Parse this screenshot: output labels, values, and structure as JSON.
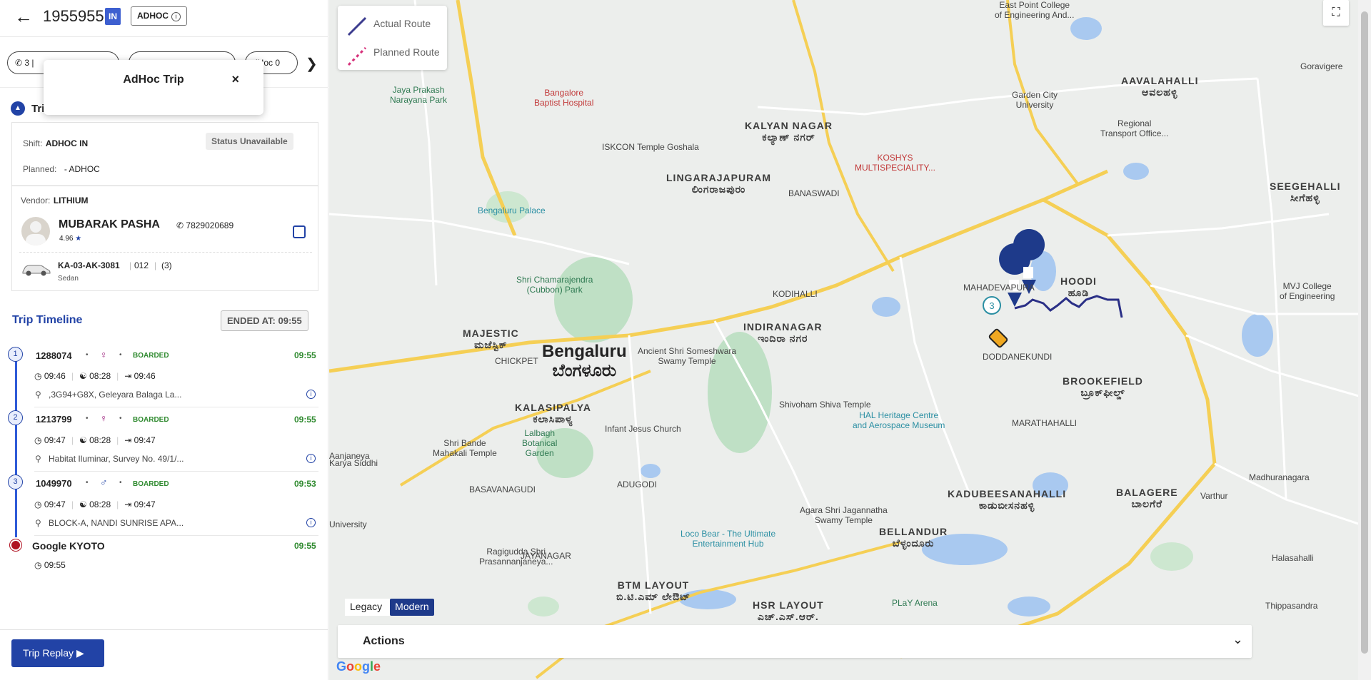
{
  "header": {
    "trip_id": "1955955",
    "direction_badge": "IN",
    "type_badge": "ADHOC",
    "info_icon": "info-icon",
    "back_icon": "arrow-left-icon"
  },
  "chips": {
    "first_count": "3",
    "third_label": "dHoc 0",
    "next_icon": "chevron-right-icon",
    "dot_colors": [
      "#3bb143",
      "#d32f2f"
    ]
  },
  "popup": {
    "title": "AdHoc Trip",
    "close": "×"
  },
  "trip": {
    "collapse_icon": "chevron-up-icon",
    "label": "Tri",
    "shift_label": "Shift:",
    "shift_value": "ADHOC IN",
    "status": "Status Unavailable",
    "planned_label": "Planned:",
    "planned_value": "- ADHOC"
  },
  "vendor": {
    "label": "Vendor:",
    "value": "LITHIUM"
  },
  "driver": {
    "name": "MUBARAK PASHA",
    "phone": "7829020689",
    "rating": "4.96",
    "edit_icon": "edit-icon"
  },
  "vehicle": {
    "plate": "KA-03-AK-3081",
    "code": "012",
    "count": "(3)",
    "type": "Sedan",
    "icon": "car-icon"
  },
  "timeline": {
    "title": "Trip Timeline",
    "ended": "ENDED AT: 09:55",
    "stops": [
      {
        "num": "1",
        "emp_id": "1288074",
        "gender": "♀",
        "status": "BOARDED",
        "time": "09:55",
        "t1": "09:46",
        "t2": "08:28",
        "t3": "09:46",
        "address": ",3G94+G8X, Geleyara Balaga La..."
      },
      {
        "num": "2",
        "emp_id": "1213799",
        "gender": "♀",
        "status": "BOARDED",
        "time": "09:55",
        "t1": "09:47",
        "t2": "08:28",
        "t3": "09:47",
        "address": "Habitat Iluminar, Survey No. 49/1/..."
      },
      {
        "num": "3",
        "emp_id": "1049970",
        "gender": "♂",
        "status": "BOARDED",
        "time": "09:53",
        "t1": "09:47",
        "t2": "08:28",
        "t3": "09:47",
        "address": "BLOCK-A, NANDI SUNRISE APA..."
      }
    ],
    "destination": {
      "name": "Google KYOTO",
      "time": "09:55",
      "sub_time": "09:55"
    }
  },
  "footer": {
    "replay_label": "Trip Replay",
    "replay_icon": "play-icon"
  },
  "map": {
    "legend": {
      "actual": "Actual Route",
      "planned": "Planned Route",
      "actual_color": "#3d3d8f",
      "planned_color": "#d6307a"
    },
    "route_color": "#2a2f86",
    "toggle": {
      "legacy": "Legacy",
      "modern": "Modern",
      "selected": "Modern"
    },
    "actions_label": "Actions",
    "google_label": "Google",
    "labels": {
      "bengaluru": "Bengaluru",
      "bengaluru_kn": "ಬೆಂಗಳೂರು",
      "kalyan": "KALYAN NAGAR",
      "kalyan_kn": "ಕಲ್ಯಾಣ್ ನಗರ್",
      "lingarajapuram": "LINGARAJAPURAM",
      "lingarajapuram_kn": "ಲಿಂಗರಾಜಪುರಂ",
      "indiranagar": "INDIRANAGAR",
      "indiranagar_kn": "ಇಂದಿರಾ ನಗರ",
      "majestic": "MAJESTIC",
      "majestic_kn": "ಮಜೆಸ್ಟಿಕ್",
      "kalasipalya": "KALASIPALYA",
      "kalasipalya_kn": "ಕಲಾಸಿಪಾಳ್ಯ",
      "brookefield": "BROOKEFIELD",
      "brookefield_kn": "ಬ್ರೂಕ್‌ಫೀಲ್ಡ್",
      "kadubeesanahalli": "KADUBEESANAHALLI",
      "kadubeesanahalli_kn": "ಕಾಡುಬೀಸನಹಳ್ಳಿ",
      "bellandur": "BELLANDUR",
      "bellandur_kn": "ಬೆಳ್ಳಂದೂರು",
      "btm": "BTM LAYOUT",
      "btm_kn": "ಬಿ.ಟಿ.ಎಮ್ ಲೇಔಟ್",
      "hsr": "HSR LAYOUT",
      "hsr_kn": "ಎಚ್.ಎಸ್.ಆರ್.",
      "hoodi": "HOODI",
      "hoodi_kn": "ಹೂಡಿ",
      "seegehalli": "SEEGEHALLI",
      "seegehalli_kn": "ಸೀಗೆಹಳ್ಳಿ",
      "aavalahalli": "AAVALAHALLI",
      "aavalahalli_kn": "ಆವಲಹಳ್ಳಿ",
      "balagere": "BALAGERE",
      "balagere_kn": "ಬಾಲಗೆರೆ",
      "cubbon": "Shri Chamarajendra\n(Cubbon) Park",
      "palace": "Bengaluru Palace",
      "iskcon": "ISKCON Temple Goshala",
      "koshys": "KOSHYS\nMULTISPECIALITY...",
      "baptist": "Bangalore\nBaptist Hospital",
      "jayaprakash": "Jaya Prakash\nNarayana Park",
      "hal": "HAL Heritage Centre\nand Aerospace Museum",
      "shivoham": "Shivoham Shiva Temple",
      "someshwara": "Ancient Shri Someshwara\nSwamy Temple",
      "lalbagh": "Lalbagh\nBotanical\nGarden",
      "infant": "Infant Jesus Church",
      "bande": "Shri Bande\nMahakali Temple",
      "locobear": "Loco Bear - The Ultimate\nEntertainment Hub",
      "agara": "Agara Shri Jagannatha\nSwamy Temple",
      "play": "PLaY Arena",
      "garden": "Garden City\nUniversity",
      "regional": "Regional\nTransport Office...",
      "mvj": "MVJ College\nof Engineering",
      "eastpoint": "East Point College\nof Engineering And...",
      "goravigere": "Goravigere",
      "madhuranagara": "Madhuranagara",
      "halasahalli": "Halasahalli",
      "thippasandra": "Thippasandra",
      "varthur": "Varthur",
      "ragigudda": "Ragigudda Shri\nPrasannanjaneya...",
      "aanjaneya": "Aanjaneya",
      "karya": "Karya Siddhi",
      "university": "University",
      "chickpet": "CHICKPET",
      "basavanagudi": "BASAVANAGUDI",
      "adugodi": "ADUGODI",
      "jayanagar": "JAYANAGAR",
      "doddanekundi": "DODDANEKUNDI",
      "mahadevapura": "MAHADEVAPURA",
      "marathahalli": "MARATHAHALLI",
      "banaswadi": "BANASWADI",
      "kodihalli": "KODIHALLI"
    }
  }
}
